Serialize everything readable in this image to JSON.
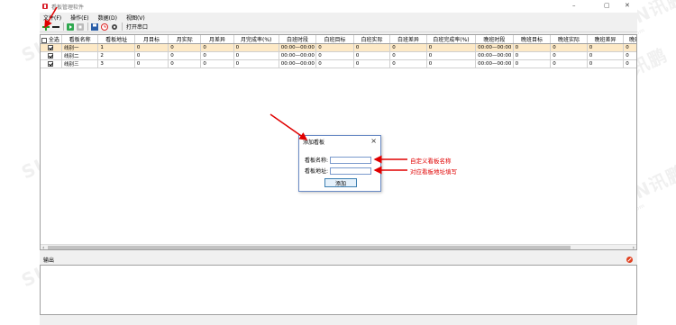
{
  "window": {
    "title": "看板管理软件",
    "controls": [
      "–",
      "▢",
      "✕"
    ]
  },
  "menu": [
    "文件(F)",
    "操作(E)",
    "数据(D)",
    "视图(V)"
  ],
  "toolbar": {
    "open_port_label": "打开串口",
    "icons": [
      "add-icon",
      "remove-icon",
      "play-icon",
      "stop-icon",
      "save-icon",
      "clock-icon",
      "gear-icon",
      "port-icon"
    ]
  },
  "table": {
    "columns": [
      "全选",
      "看板名称",
      "看板地址",
      "月目标",
      "月实际",
      "月差异",
      "月完成率(%)",
      "白班时段",
      "白班目标",
      "白班实际",
      "白班差异",
      "白班完成率(%)",
      "晚班时段",
      "晚班目标",
      "晚班实际",
      "晚班差异",
      "晚班完成率"
    ],
    "rows": [
      {
        "checked": true,
        "cells": [
          "线别一",
          "1",
          "0",
          "0",
          "0",
          "0",
          "00:00—00:00",
          "0",
          "0",
          "0",
          "0",
          "00:00—00:00",
          "0",
          "0",
          "0",
          "0"
        ]
      },
      {
        "checked": true,
        "cells": [
          "线别二",
          "2",
          "0",
          "0",
          "0",
          "0",
          "00:00—00:00",
          "0",
          "0",
          "0",
          "0",
          "00:00—00:00",
          "0",
          "0",
          "0",
          "0"
        ]
      },
      {
        "checked": true,
        "cells": [
          "线别三",
          "3",
          "0",
          "0",
          "0",
          "0",
          "00:00—00:00",
          "0",
          "0",
          "0",
          "0",
          "00:00—00:00",
          "0",
          "0",
          "0",
          "0"
        ]
      }
    ],
    "selected_row": 0
  },
  "output": {
    "label": "输出"
  },
  "dialog": {
    "title": "添加看板",
    "name_label": "看板名称:",
    "name_value": "",
    "address_label": "看板地址:",
    "address_value": "",
    "add_button": "添加"
  },
  "annotations": {
    "name_hint": "自定义看板名称",
    "address_hint": "对应看板地址填写"
  },
  "watermark": {
    "brand": "SUNPN讯鹏",
    "site": "www.sunpn.com"
  },
  "colors": {
    "selected_row": "#fde9c6",
    "annotation_red": "#e00000",
    "dialog_border": "#6a8bc5"
  }
}
